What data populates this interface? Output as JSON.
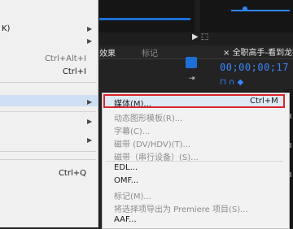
{
  "main_menu": {
    "items": [
      {
        "label": "K)",
        "shortcut": "",
        "submenu": true
      },
      {
        "label": "",
        "shortcut": "",
        "submenu": true
      },
      {
        "label": "",
        "shortcut": "Ctrl+Alt+I",
        "submenu": false
      },
      {
        "label": "",
        "shortcut": "Ctrl+I",
        "submenu": false
      },
      {
        "label": "",
        "shortcut": "",
        "submenu": true
      },
      {
        "label": "",
        "shortcut": "",
        "submenu": true
      },
      {
        "label": "",
        "shortcut": "",
        "submenu": true
      },
      {
        "label": "",
        "shortcut": "",
        "submenu": true
      },
      {
        "label": "",
        "shortcut": "Ctrl+Q",
        "submenu": false
      }
    ]
  },
  "export_submenu": {
    "items": [
      {
        "label": "媒体(M)...",
        "shortcut": "Ctrl+M",
        "enabled": true,
        "highlighted": true
      },
      {
        "label": "动态图形模板(R)...",
        "enabled": false
      },
      {
        "label": "字幕(C)...",
        "enabled": false
      },
      {
        "label": "磁带 (DV/HDV)(T)...",
        "enabled": false
      },
      {
        "label": "磁带（串行设备）(S)...",
        "enabled": false
      },
      {
        "label": "EDL...",
        "enabled": true
      },
      {
        "label": "OMF...",
        "enabled": true
      },
      {
        "label": "标记(M)...",
        "enabled": false
      },
      {
        "label": "将选择项导出为 Premiere 项目(S)...",
        "enabled": false
      },
      {
        "label": "AAF...",
        "enabled": true
      }
    ]
  },
  "app": {
    "panel_tab_effects": "效果",
    "panel_tab_markers": "标记",
    "sequence_title": "全职高手-看到龙抬",
    "timecode": "00;00;00;17"
  }
}
